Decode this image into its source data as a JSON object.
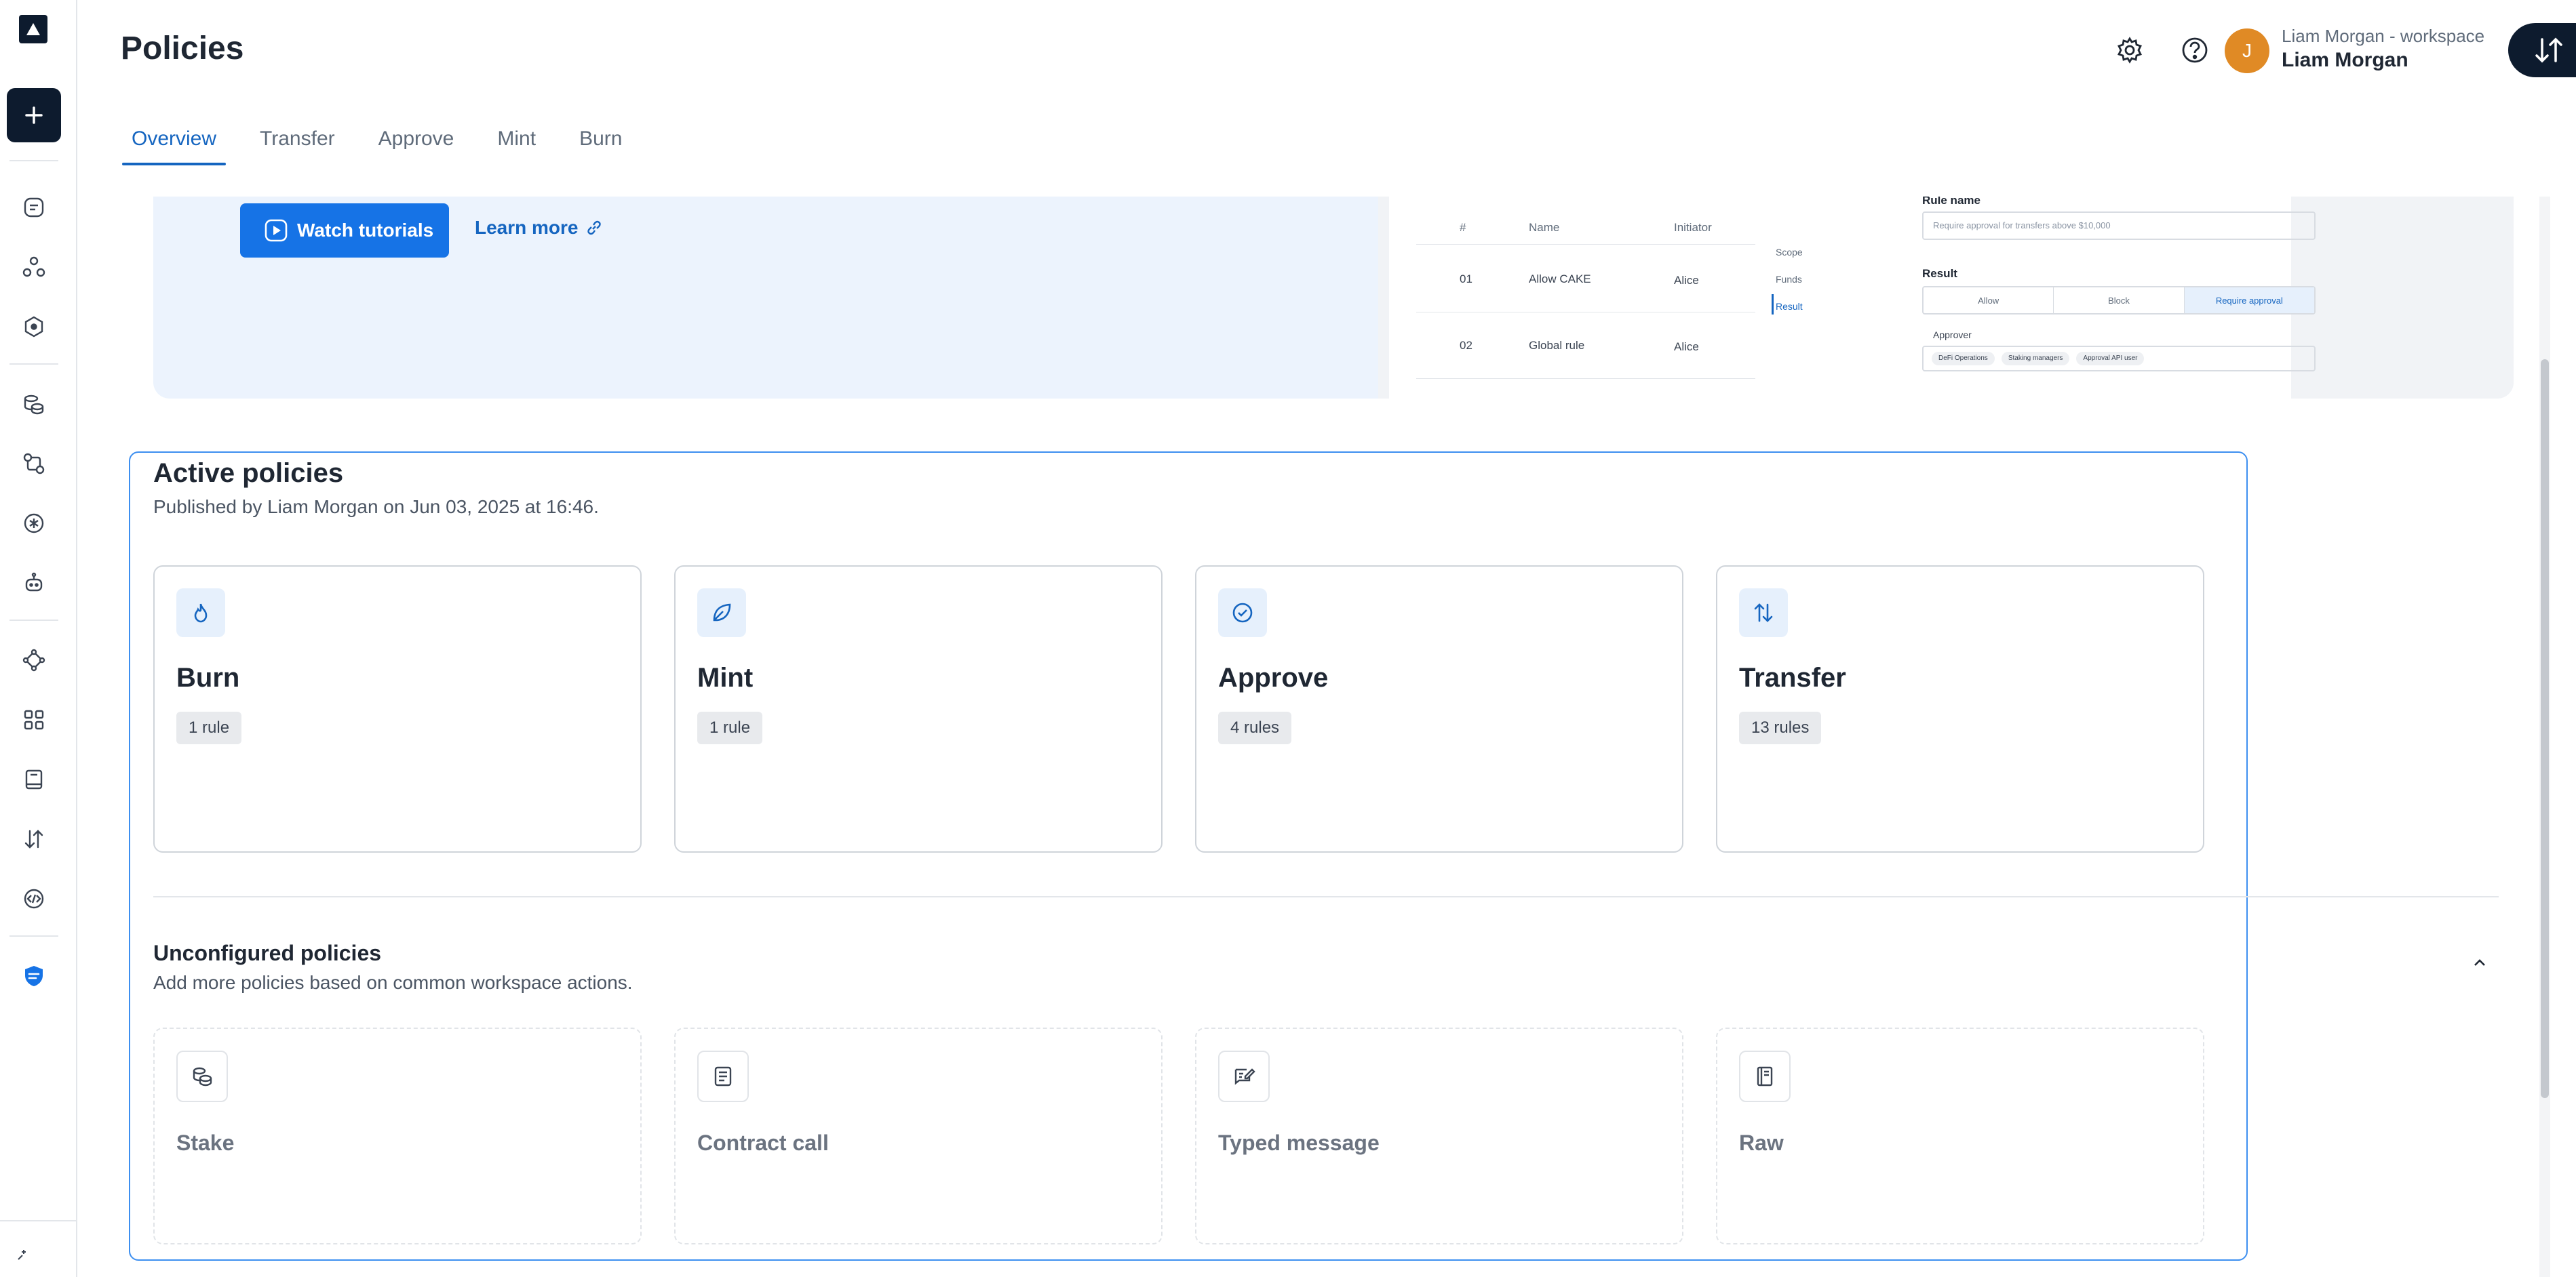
{
  "app": {
    "page_title": "Policies",
    "workspace_label": "Liam Morgan - workspace",
    "user_name": "Liam Morgan",
    "avatar_initial": "J"
  },
  "tabs": [
    {
      "label": "Overview",
      "active": true
    },
    {
      "label": "Transfer",
      "active": false
    },
    {
      "label": "Approve",
      "active": false
    },
    {
      "label": "Mint",
      "active": false
    },
    {
      "label": "Burn",
      "active": false
    }
  ],
  "banner": {
    "watch_label": "Watch tutorials",
    "learn_label": "Learn more",
    "preview": {
      "table_headers": [
        "#",
        "Name",
        "Initiator"
      ],
      "rows": [
        {
          "num": "01",
          "name": "Allow CAKE",
          "initiator": "Alice"
        },
        {
          "num": "02",
          "name": "Global rule",
          "initiator": "Alice"
        }
      ],
      "nav": [
        "Scope",
        "Funds",
        "Result"
      ],
      "rule_name_label": "Rule name",
      "rule_name_value": "Require approval for transfers above $10,000",
      "result_label": "Result",
      "result_options": [
        "Allow",
        "Block",
        "Require approval"
      ],
      "approver_label": "Approver",
      "approver_chips": [
        "DeFi Operations",
        "Staking managers",
        "Approval API user"
      ]
    }
  },
  "active_policies": {
    "title": "Active policies",
    "subtitle": "Published by Liam Morgan on Jun 03, 2025 at 16:46.",
    "cards": [
      {
        "name": "Burn",
        "badge": "1 rule",
        "icon": "flame-icon"
      },
      {
        "name": "Mint",
        "badge": "1 rule",
        "icon": "leaf-icon"
      },
      {
        "name": "Approve",
        "badge": "4 rules",
        "icon": "check-circle-icon"
      },
      {
        "name": "Transfer",
        "badge": "13 rules",
        "icon": "arrows-up-down-icon"
      }
    ]
  },
  "unconfigured_policies": {
    "title": "Unconfigured policies",
    "subtitle": "Add more policies based on common workspace actions.",
    "cards": [
      {
        "name": "Stake",
        "icon": "coins-icon"
      },
      {
        "name": "Contract call",
        "icon": "contract-icon"
      },
      {
        "name": "Typed message",
        "icon": "message-edit-icon"
      },
      {
        "name": "Raw",
        "icon": "book-icon"
      }
    ]
  },
  "colors": {
    "accent": "#1673e6",
    "nav_dark": "#0d1b2e",
    "active_border": "#3d8ff0",
    "avatar": "#e08a25"
  }
}
